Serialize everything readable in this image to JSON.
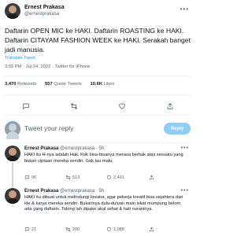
{
  "author": {
    "display_name": "Ernest Prakasa",
    "handle": "@ernestprakasa"
  },
  "tweet": {
    "text": "Daftarin OPEN MIC ke HAKI. Daftarin ROASTING ke HAKI. Daftarin CITAYAM FASHION WEEK ke HAKI. Serakah banget jadi manusia.",
    "translate_label": "Translate Tweet",
    "meta": "3:55 PM · Jul 24, 2022 · Twitter for iPhone"
  },
  "stats": {
    "retweets": "3,470",
    "retweets_label": "Retweets",
    "quotes": "557",
    "quotes_label": "Quote Tweets",
    "likes": "10.6K",
    "likes_label": "Likes"
  },
  "composer": {
    "placeholder": "Tweet your reply",
    "button_label": "Reply"
  },
  "replies": [
    {
      "name": "Ernest Prakasa",
      "handle": "@ernestprakasa · 5h",
      "text": "HAKI itu H-nya adalah Hak. Kok bisa-bisanya merasa berhak atas sesuatu yang bukan ciptaan mereka sendiri. Gak tau malu.",
      "replies": "96",
      "retweets": "513",
      "likes": "2,491"
    },
    {
      "name": "Ernest Prakasa",
      "handle": "@ernestprakasa · 5h",
      "text": "HAKI itu dibuat untuk melindungi kreator, agar pekerja kreatif bisa sejahtera dari ide & karya mereka sendiri. Bukannya dulu-duluan main sikat mumpung belom ada yang daftarin. Tolong lah dipake akal sehat & hati nuraninya.",
      "replies": "21",
      "retweets": "200",
      "likes": "1,088"
    }
  ],
  "colors": {
    "accent": "#1d9bf0",
    "text": "#0f1419",
    "secondary": "#536471"
  },
  "icons": [
    "more-icon",
    "reply-icon",
    "retweet-icon",
    "like-icon",
    "share-icon"
  ]
}
